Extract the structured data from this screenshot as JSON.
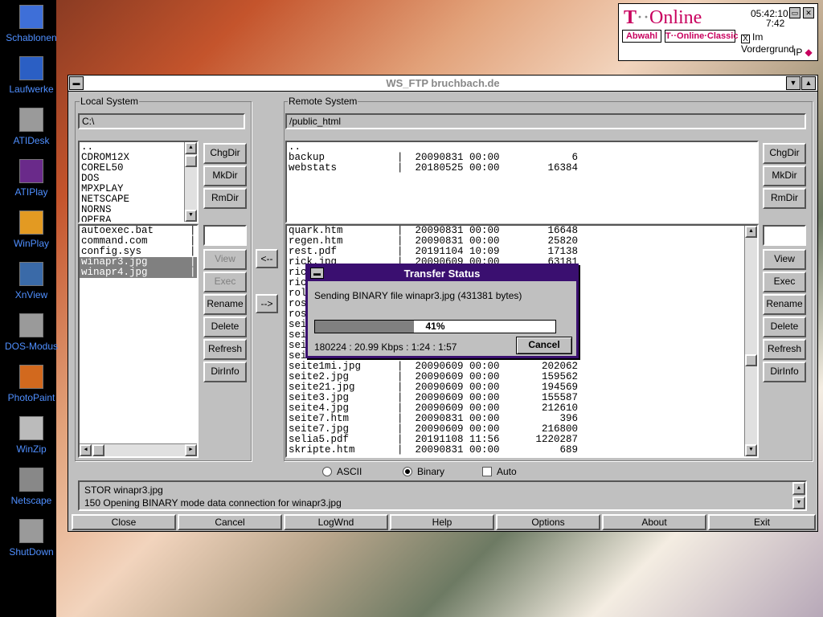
{
  "desktop": {
    "icons": [
      {
        "label": "Schablonen",
        "icon": "finder-face-icon",
        "color": "#3e6fd8"
      },
      {
        "label": "Laufwerke",
        "icon": "drive-icon",
        "color": "#2b5fc4"
      },
      {
        "label": "ATIDesk",
        "icon": "monitor-icon",
        "color": "#9a9a9a"
      },
      {
        "label": "ATIPlay",
        "icon": "media-player-icon",
        "color": "#6a2a8a"
      },
      {
        "label": "WinPlay",
        "icon": "winplay-icon",
        "color": "#e39a22"
      },
      {
        "label": "XnView",
        "icon": "image-viewer-icon",
        "color": "#3a6aa8"
      },
      {
        "label": "DOS-Modus",
        "icon": "dos-terminal-icon",
        "color": "#9a9a9a"
      },
      {
        "label": "PhotoPaint",
        "icon": "photopaint-icon",
        "color": "#d2691e"
      },
      {
        "label": "WinZip",
        "icon": "winzip-icon",
        "color": "#bbbbbb"
      },
      {
        "label": "Netscape",
        "icon": "magnifier-icon",
        "color": "#888888"
      },
      {
        "label": "ShutDown",
        "icon": "shutdown-terminal-icon",
        "color": "#9a9a9a"
      }
    ]
  },
  "tonline": {
    "logo_t": "T",
    "logo_dots": "··",
    "logo_word": "Online",
    "time1": "05:42:10",
    "time2": "7:42",
    "btn_abwahl": "Abwahl",
    "btn_classic": "T··Online·Classic",
    "check_label": "Im Vordergrund",
    "check_mark": "X",
    "ip_label": "IP"
  },
  "window": {
    "title": "WS_FTP bruchbach.de",
    "local": {
      "label": "Local System",
      "path": "C:\\",
      "dirs": [
        "..",
        "CDROM12X",
        "COREL50",
        "DOS",
        "MPXPLAY",
        "NETSCAPE",
        "NORNS",
        "OPERA"
      ],
      "files": [
        {
          "name": "autoexec.bat",
          "selected": false
        },
        {
          "name": "command.com",
          "selected": false
        },
        {
          "name": "config.sys",
          "selected": false
        },
        {
          "name": "winapr3.jpg",
          "selected": true
        },
        {
          "name": "winapr4.jpg",
          "selected": true
        }
      ]
    },
    "remote": {
      "label": "Remote System",
      "path": "/public_html",
      "dirs": [
        {
          "name": "..",
          "date": "",
          "size": ""
        },
        {
          "name": "backup",
          "date": "20090831 00:00",
          "size": "6"
        },
        {
          "name": "webstats",
          "date": "20180525 00:00",
          "size": "16384"
        }
      ],
      "files": [
        {
          "name": "quark.htm",
          "date": "20090831 00:00",
          "size": "16648"
        },
        {
          "name": "regen.htm",
          "date": "20090831 00:00",
          "size": "25820"
        },
        {
          "name": "rest.pdf",
          "date": "20191104 10:09",
          "size": "17138"
        },
        {
          "name": "rick.jpg",
          "date": "20090609 00:00",
          "size": "63181"
        },
        {
          "name": "ric",
          "date": "",
          "size": ""
        },
        {
          "name": "ric",
          "date": "",
          "size": ""
        },
        {
          "name": "rol",
          "date": "",
          "size": ""
        },
        {
          "name": "ros",
          "date": "",
          "size": ""
        },
        {
          "name": "ros",
          "date": "",
          "size": ""
        },
        {
          "name": "sei",
          "date": "",
          "size": ""
        },
        {
          "name": "sei",
          "date": "",
          "size": ""
        },
        {
          "name": "sei",
          "date": "",
          "size": ""
        },
        {
          "name": "sei",
          "date": "",
          "size": ""
        },
        {
          "name": "seite1mi.jpg",
          "date": "20090609 00:00",
          "size": "202062"
        },
        {
          "name": "seite2.jpg",
          "date": "20090609 00:00",
          "size": "159562"
        },
        {
          "name": "seite21.jpg",
          "date": "20090609 00:00",
          "size": "194569"
        },
        {
          "name": "seite3.jpg",
          "date": "20090609 00:00",
          "size": "155587"
        },
        {
          "name": "seite4.jpg",
          "date": "20090609 00:00",
          "size": "212610"
        },
        {
          "name": "seite7.htm",
          "date": "20090831 00:00",
          "size": "396"
        },
        {
          "name": "seite7.jpg",
          "date": "20090609 00:00",
          "size": "216800"
        },
        {
          "name": "selia5.pdf",
          "date": "20191108 11:56",
          "size": "1220287"
        },
        {
          "name": "skripte.htm",
          "date": "20090831 00:00",
          "size": "689"
        }
      ]
    },
    "local_buttons": {
      "chgdir": "ChgDir",
      "mkdir": "MkDir",
      "rmdir": "RmDir",
      "view": "View",
      "exec": "Exec",
      "rename": "Rename",
      "delete": "Delete",
      "refresh": "Refresh",
      "dirinfo": "DirInfo"
    },
    "remote_buttons": {
      "chgdir": "ChgDir",
      "mkdir": "MkDir",
      "rmdir": "RmDir",
      "view": "View",
      "exec": "Exec",
      "rename": "Rename",
      "delete": "Delete",
      "refresh": "Refresh",
      "dirinfo": "DirInfo"
    },
    "transfer": {
      "upload": "<--",
      "download": "-->"
    },
    "modes": {
      "ascii": "ASCII",
      "binary": "Binary",
      "auto": "Auto",
      "selected": "binary"
    },
    "status_lines": [
      "STOR winapr3.jpg",
      "150 Opening BINARY mode data connection for winapr3.jpg"
    ],
    "bottom_buttons": [
      "Close",
      "Cancel",
      "LogWnd",
      "Help",
      "Options",
      "About",
      "Exit"
    ]
  },
  "dialog": {
    "title": "Transfer Status",
    "message": "Sending BINARY file winapr3.jpg (431381 bytes)",
    "progress_fraction": 0.41,
    "progress_text": "41%",
    "stats": "180224 : 20.99 Kbps : 1:24 : 1:57",
    "cancel_label": "Cancel"
  }
}
